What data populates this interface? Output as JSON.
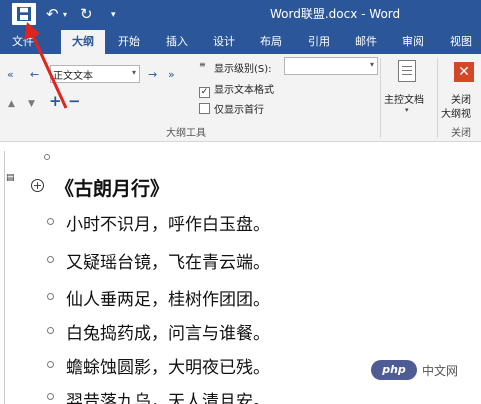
{
  "title_bar": {
    "doc_title": "Word联盟.docx - Word",
    "undo_glyph": "↶",
    "redo_glyph": "↻",
    "customize_glyph": "▾"
  },
  "tabs": [
    {
      "label": "文件",
      "active": false
    },
    {
      "label": "大纲",
      "active": true
    },
    {
      "label": "开始",
      "active": false
    },
    {
      "label": "插入",
      "active": false
    },
    {
      "label": "设计",
      "active": false
    },
    {
      "label": "布局",
      "active": false
    },
    {
      "label": "引用",
      "active": false
    },
    {
      "label": "邮件",
      "active": false
    },
    {
      "label": "审阅",
      "active": false
    },
    {
      "label": "视图",
      "active": false
    }
  ],
  "ribbon": {
    "outline_tools": {
      "promote_to_heading": "«",
      "promote": "←",
      "level_value": "正文文本",
      "demote": "→",
      "demote_to_body": "»",
      "move_up": "▲",
      "move_down": "▼",
      "expand": "+",
      "collapse": "−",
      "show_level_label": "显示级别(S):",
      "show_level_value": "",
      "show_text_formatting": "显示文本格式",
      "show_text_formatting_checked": true,
      "show_first_line_only": "仅显示首行",
      "show_first_line_only_checked": false,
      "group_label": "大纲工具"
    },
    "master_document": {
      "label": "主控文档"
    },
    "close": {
      "label_line1": "关闭",
      "label_line2": "大纲视",
      "group_label": "关闭"
    }
  },
  "document": {
    "title": "《古朗月行》",
    "lines": [
      "小时不识月，呼作白玉盘。",
      "又疑瑶台镜，飞在青云端。",
      "仙人垂两足，桂树作团团。",
      "白兔捣药成，问言与谁餐。",
      "蟾蜍蚀圆影，大明夜已残。",
      "羿昔落九乌，天人清且安。"
    ]
  },
  "watermark": {
    "badge": "php",
    "site": "中文网"
  },
  "colors": {
    "brand": "#2b579a",
    "annotation": "#e0231b",
    "close_outline": "#d24726"
  }
}
